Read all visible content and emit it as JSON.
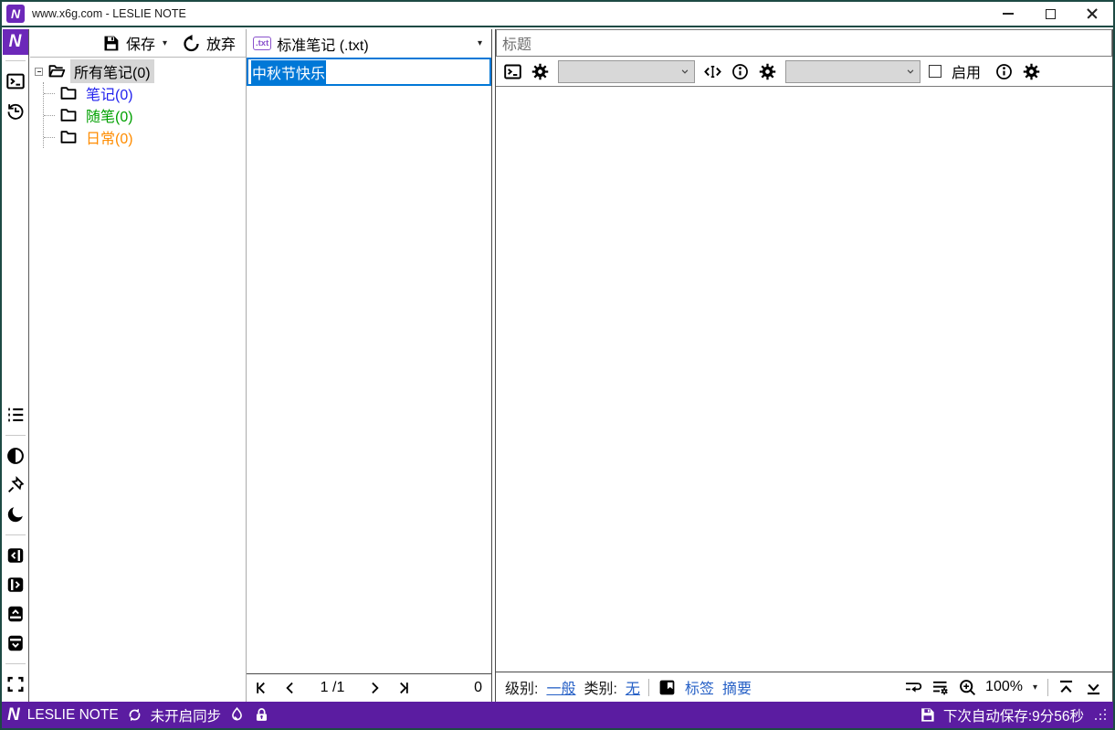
{
  "titlebar": {
    "title": "www.x6g.com - LESLIE NOTE"
  },
  "toolbar": {
    "save_label": "保存",
    "discard_label": "放弃",
    "txt_badge": ".txt",
    "note_type": "标准笔记 (.txt)"
  },
  "tree": {
    "items": [
      {
        "label": "所有笔记(0)",
        "color": "#000000",
        "selected": true
      },
      {
        "label": "笔记(0)",
        "color": "#2222ee",
        "selected": false
      },
      {
        "label": "随笔(0)",
        "color": "#00a000",
        "selected": false
      },
      {
        "label": "日常(0)",
        "color": "#ff8c00",
        "selected": false
      }
    ]
  },
  "list": {
    "items": [
      {
        "title": "中秋节快乐",
        "selected": true
      }
    ],
    "pager": {
      "page": "1",
      "total": "/1",
      "count": "0"
    }
  },
  "editor": {
    "title_placeholder": "标题",
    "enable_label": "启用",
    "zoom": "100%",
    "meta": {
      "level_label": "级别:",
      "level_value": "一般",
      "category_label": "类别:",
      "category_value": "无",
      "tags": "标签",
      "summary": "摘要"
    }
  },
  "status": {
    "app": "LESLIE NOTE",
    "sync": "未开启同步",
    "autosave": "下次自动保存:9分56秒"
  },
  "colors": {
    "brand_purple": "#6c28b9",
    "statusbar_purple": "#5b1ca1",
    "selection_blue": "#0078d7",
    "link_blue": "#2660c6",
    "window_border": "#1d4a44"
  },
  "icons": {
    "app_logo": "purple-N-square",
    "save": "floppy-disk",
    "discard": "undo-arrow",
    "terminal": "prompt-box",
    "history": "clock-arrow",
    "list": "bullet-list",
    "contrast": "half-circle",
    "pin": "pushpin",
    "dark_mode": "moon",
    "collapse_left": "panel-chevron-left",
    "collapse_right": "panel-chevron-right",
    "collapse_up": "panel-chevron-up",
    "collapse_down": "panel-chevron-down",
    "fullscreen": "corner-brackets",
    "settings": "gear",
    "info": "circle-i",
    "cursor_tag": "angle-brackets-ibeam",
    "bookmark": "filled-bookmark",
    "word_wrap": "wrap-arrow-lines",
    "list_settings": "lines-gear",
    "zoom_in": "magnifier-plus",
    "scroll_top": "line-chevron-up",
    "scroll_bottom": "chevron-down-line",
    "sync": "circular-arrows",
    "flame": "flame-drop",
    "lock": "padlock",
    "resize_grip": "dot-grid"
  }
}
